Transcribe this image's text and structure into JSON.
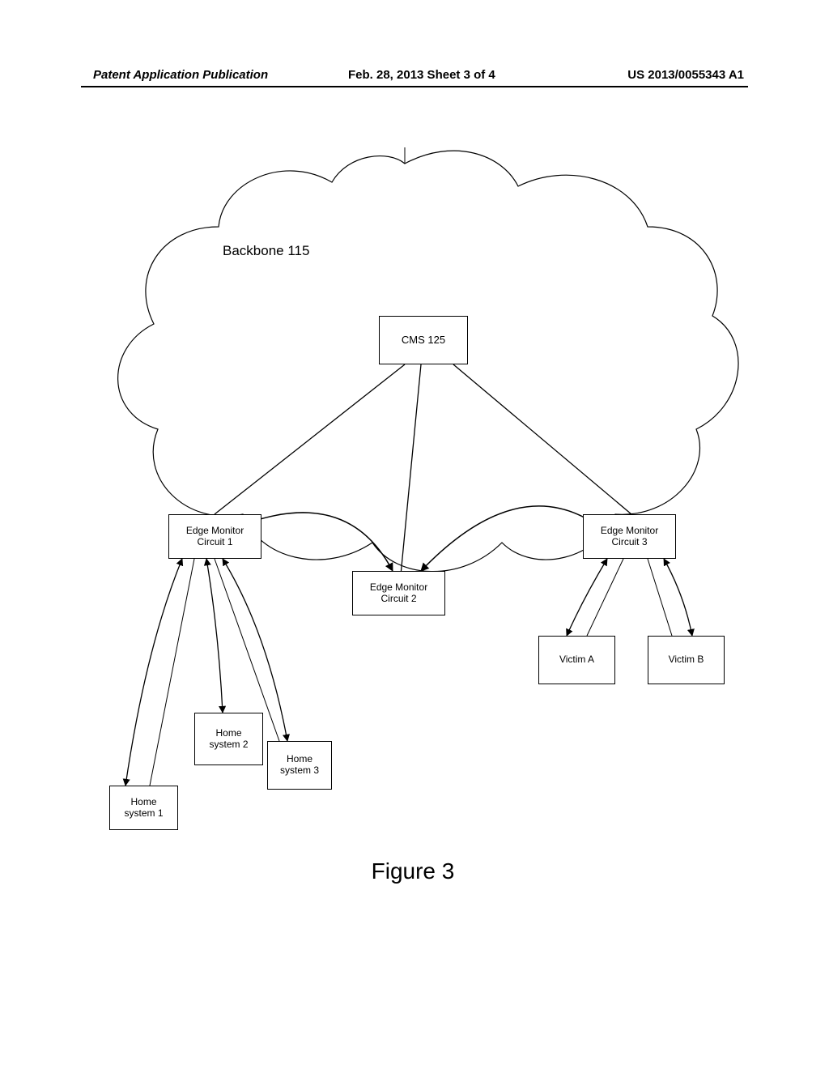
{
  "header": {
    "left": "Patent Application Publication",
    "center": "Feb. 28, 2013  Sheet 3 of 4",
    "right": "US 2013/0055343 A1"
  },
  "diagram": {
    "backbone_label": "Backbone 115",
    "cms_label": "CMS 125",
    "edge1": "Edge Monitor\nCircuit 1",
    "edge2": "Edge Monitor\nCircuit 2",
    "edge3": "Edge Monitor\nCircuit 3",
    "home1": "Home\nsystem 1",
    "home2": "Home\nsystem 2",
    "home3": "Home\nsystem 3",
    "victimA": "Victim A",
    "victimB": "Victim B",
    "figure_caption": "Figure 3"
  }
}
